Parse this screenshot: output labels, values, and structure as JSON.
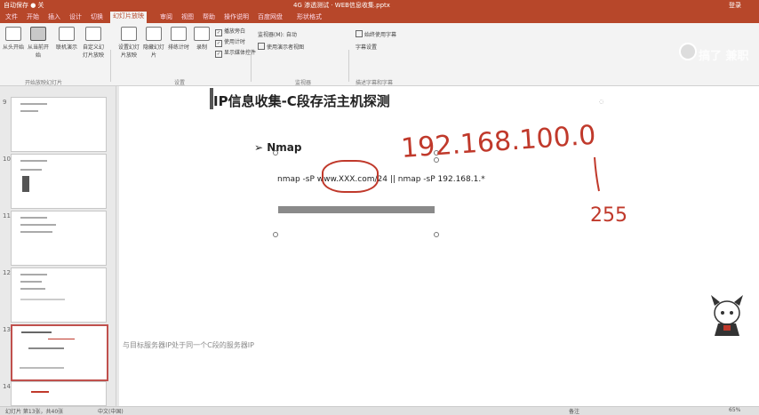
{
  "titlebar": {
    "left_text": "自动保存 ● 关",
    "center_text": "4G 渗透测试 · WEB信息收集.pptx",
    "right_text": "登录"
  },
  "tabs": [
    {
      "label": "文件",
      "active": false
    },
    {
      "label": "开始",
      "active": false
    },
    {
      "label": "插入",
      "active": false
    },
    {
      "label": "设计",
      "active": false
    },
    {
      "label": "切换",
      "active": false
    },
    {
      "label": "幻灯片放映",
      "active": true
    },
    {
      "label": "审阅",
      "active": false
    },
    {
      "label": "视图",
      "active": false
    },
    {
      "label": "帮助",
      "active": false
    },
    {
      "label": "操作说明",
      "active": false
    },
    {
      "label": "百度网盘",
      "active": false
    },
    {
      "label": "形状格式",
      "active": false
    }
  ],
  "ribbon": {
    "from_start": "从头开始",
    "from_current": "从当前开始",
    "online": "联机演示",
    "custom": "自定义幻灯片放映",
    "setup": "设置幻灯片放映",
    "hide": "隐藏幻灯片",
    "rehearse": "排练计时",
    "record": "录制",
    "group_start": "开始放映幻灯片",
    "group_setup": "设置",
    "group_monitor": "监视器",
    "group_caption": "描述字幕和字幕",
    "chk_narration": "播放旁白",
    "chk_timing": "使用计时",
    "chk_controls": "显示媒体控件",
    "monitor_label": "监视器(M):",
    "monitor_value": "自动",
    "presenter_view": "使用演示者视图",
    "always_caption": "始终使用字幕",
    "caption_settings": "字幕设置"
  },
  "logo": "搞了 兼职",
  "thumbnails": [
    {
      "num": "9",
      "active": false
    },
    {
      "num": "10",
      "active": false
    },
    {
      "num": "11",
      "active": false
    },
    {
      "num": "12",
      "active": false
    },
    {
      "num": "13",
      "active": true
    },
    {
      "num": "14",
      "active": false
    }
  ],
  "slide": {
    "title": "IP信息收集-C段存活主机探测",
    "bullet_marker": "➢",
    "bullet": "Nmap",
    "command": "nmap -sP www.XXX.com/24 || nmap -sP 192.168.1.*",
    "footer": "与目标服务器IP处于同一个C段的服务器IP",
    "handwriting": {
      "ip": "192.168.100.0",
      "range_end": "255"
    }
  },
  "status": {
    "slide_info": "幻灯片 第13张，共40张",
    "language": "中文(中国)",
    "notes": "备注",
    "zoom": "65%"
  },
  "colors": {
    "accent": "#b7472a",
    "annotation": "#c0392b"
  }
}
